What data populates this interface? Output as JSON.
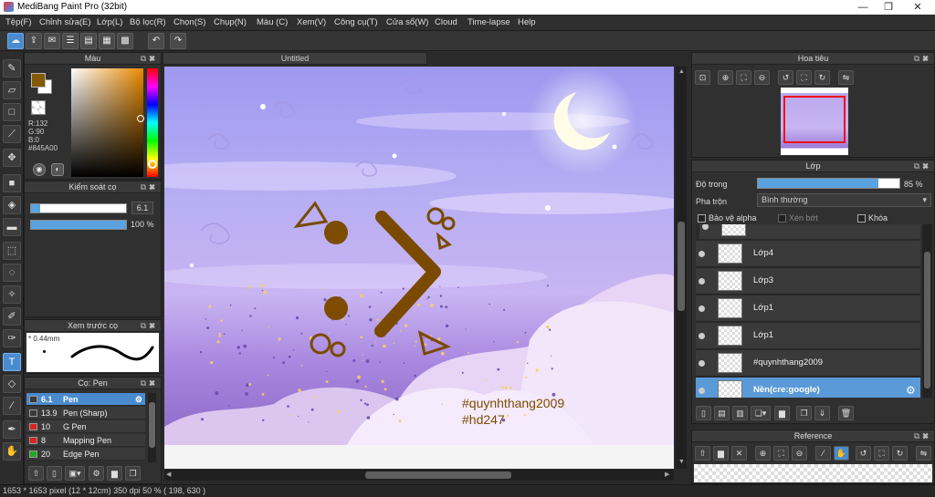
{
  "window": {
    "title": "MediBang Paint Pro (32bit)",
    "controls": [
      "—",
      "❐",
      "✕"
    ]
  },
  "menu": [
    "Tệp(F)",
    "Chỉnh sửa(E)",
    "Lớp(L)",
    "Bộ lọc(R)",
    "Chọn(S)",
    "Chụp(N)",
    "Màu (C)",
    "Xem(V)",
    "Công cụ(T)",
    "Cửa sổ(W)",
    "Cloud",
    "Time-lapse",
    "Help"
  ],
  "color_panel": {
    "title": "Màu",
    "r": "R:132",
    "g": "G:90",
    "b": "B:0",
    "hex": "#845A00",
    "primary_color": "#845a00",
    "secondary_color": "#ffffff"
  },
  "brush_control": {
    "title": "Kiểm soát cọ",
    "size_value": "6.1",
    "opacity_value": "100 %",
    "opacity_fraction": 1.0
  },
  "brush_preview": {
    "title": "Xem trước cọ",
    "size_label": "* 0.44mm"
  },
  "brush_list": {
    "title": "Cọ: Pen",
    "items": [
      {
        "size": "6.1",
        "name": "Pen",
        "color": "#3a3a3a",
        "selected": true
      },
      {
        "size": "13.9",
        "name": "Pen (Sharp)",
        "color": "#3a3a3a",
        "selected": false
      },
      {
        "size": "10",
        "name": "G Pen",
        "color": "#d22",
        "selected": false
      },
      {
        "size": "8",
        "name": "Mapping Pen",
        "color": "#d22",
        "selected": false
      },
      {
        "size": "20",
        "name": "Edge Pen",
        "color": "#2a2",
        "selected": false
      }
    ]
  },
  "document": {
    "tab": "Untitled",
    "watermark_lines": [
      "#quynhthang2009",
      "#hd247"
    ]
  },
  "navigator": {
    "title": "Hoa tiêu"
  },
  "layers": {
    "title": "Lớp",
    "opacity_label": "Độ trong",
    "opacity_value": "85 %",
    "opacity_fraction": 0.85,
    "blend_label": "Pha trộn",
    "blend_value": "Bình thường",
    "protect_alpha": "Bảo vệ alpha",
    "clipping": "Xén bớt",
    "lock": "Khóa",
    "items": [
      {
        "name": "Lớp4",
        "selected": false
      },
      {
        "name": "Lớp3",
        "selected": false
      },
      {
        "name": "Lớp1",
        "selected": false
      },
      {
        "name": "Lớp1",
        "selected": false
      },
      {
        "name": "#quynhthang2009",
        "selected": false
      },
      {
        "name": "Nền(cre:google)",
        "selected": true
      }
    ]
  },
  "reference": {
    "title": "Reference"
  },
  "status": {
    "text": "1653 * 1653 pixel   (12 * 12cm)   350 dpi   50 %   ( 198, 630 )"
  }
}
